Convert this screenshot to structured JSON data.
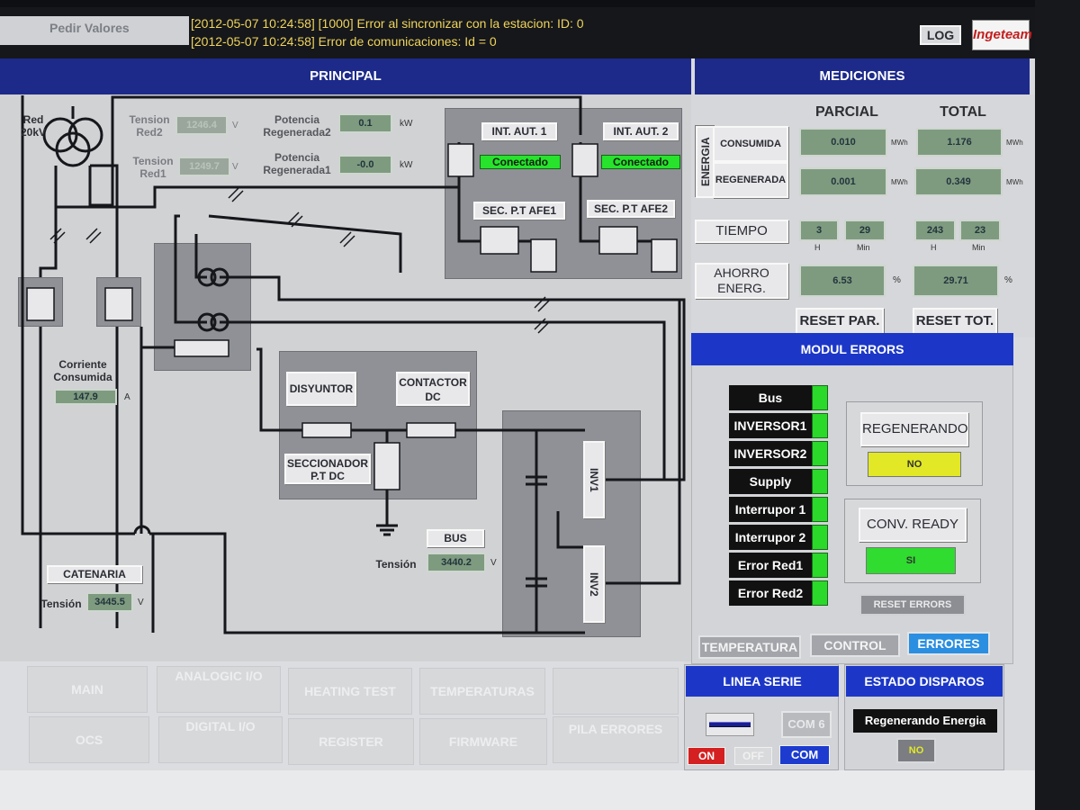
{
  "topbar": {
    "pedir_label": "Pedir Valores",
    "log_line_1": "[2012-05-07 10:24:58] [1000] Error al sincronizar con la estacion: ID: 0",
    "log_line_2": "[2012-05-07 10:24:58] Error de comunicaciones: Id = 0",
    "log_button": "LOG",
    "logo_text": "Ingeteam"
  },
  "headers": {
    "principal": "PRINCIPAL",
    "mediciones": "MEDICIONES"
  },
  "diagram": {
    "red_label": "Red\n20kV",
    "tension_red2_label": "Tension\nRed2",
    "tension_red2_value": "1246.4",
    "tension_red2_unit": "V",
    "tension_red1_label": "Tension\nRed1",
    "tension_red1_value": "1249.7",
    "tension_red1_unit": "V",
    "pot_regen2_label": "Potencia\nRegenerada2",
    "pot_regen2_value": "0.1",
    "pot_regen2_unit": "kW",
    "pot_regen1_label": "Potencia\nRegenerada1",
    "pot_regen1_value": "-0.0",
    "pot_regen1_unit": "kW",
    "int_aut1": "INT. AUT. 1",
    "int_aut2": "INT. AUT. 2",
    "conectado1": "Conectado",
    "conectado2": "Conectado",
    "sec_afe1": "SEC. P.T AFE1",
    "sec_afe2": "SEC. P.T AFE2",
    "corriente_label": "Corriente\nConsumida",
    "corriente_value": "147.9",
    "corriente_unit": "A",
    "disyuntor": "DISYUNTOR",
    "contactor": "CONTACTOR\nDC",
    "seccionador": "SECCIONADOR\nP.T DC",
    "bus_label": "BUS",
    "bus_tension_label": "Tensión",
    "bus_tension_value": "3440.2",
    "bus_tension_unit": "V",
    "catenaria_label": "CATENARIA",
    "catenaria_tension_label": "Tensión",
    "catenaria_tension_value": "3445.5",
    "catenaria_tension_unit": "V",
    "inv1": "INV1",
    "inv2": "INV2"
  },
  "mediciones": {
    "parcial_label": "PARCIAL",
    "total_label": "TOTAL",
    "energia_label": "ENERGIA",
    "consumida_label": "CONSUMIDA",
    "regenerada_label": "REGENERADA",
    "consumida_parcial": "0.010",
    "consumida_total": "1.176",
    "regenerada_parcial": "0.001",
    "regenerada_total": "0.349",
    "energy_unit": "MWh",
    "tiempo_label": "TIEMPO",
    "tiempo_parcial_h": "3",
    "tiempo_parcial_min": "29",
    "tiempo_total_h": "243",
    "tiempo_total_min": "23",
    "h_unit": "H",
    "min_unit": "Min",
    "ahorro_label": "AHORRO\nENERG.",
    "ahorro_parcial": "6.53",
    "ahorro_total": "29.71",
    "pct_unit": "%",
    "reset_par": "RESET PAR.",
    "reset_tot": "RESET TOT."
  },
  "modul_errors": {
    "title": "MODUL ERRORS",
    "items": [
      "Bus",
      "INVERSOR1",
      "INVERSOR2",
      "Supply",
      "Interrupor 1",
      "Interrupor 2",
      "Error Red1",
      "Error Red2"
    ],
    "regenerando_label": "REGENERANDO",
    "regenerando_value": "NO",
    "conv_ready_label": "CONV. READY",
    "conv_ready_value": "SI",
    "reset_errors": "RESET ERRORS",
    "tab_temperatura": "TEMPERATURA",
    "tab_control": "CONTROL",
    "tab_errores": "ERRORES"
  },
  "nav": {
    "main": "MAIN",
    "analogic_io": "ANALOGIC I/O",
    "heating_test": "HEATING TEST",
    "temperaturas": "TEMPERATURAS",
    "ocs": "OCS",
    "digital_io": "DIGITAL I/O",
    "register": "REGISTER",
    "firmware": "FIRMWARE",
    "pila_errores": "PILA ERRORES"
  },
  "linea_serie": {
    "title": "LINEA SERIE",
    "com6": "COM 6",
    "on": "ON",
    "off": "OFF",
    "com": "COM"
  },
  "estado_disparos": {
    "title": "ESTADO DISPAROS",
    "regenerando_energia": "Regenerando Energia",
    "value": "NO"
  },
  "colors": {
    "header_blue": "#1d2a8a",
    "value_green": "#7e9b80",
    "led_green": "#2ad92a",
    "yellow": "#e2e825",
    "on_red": "#d42020",
    "errores_blue": "#2a8fe0"
  }
}
